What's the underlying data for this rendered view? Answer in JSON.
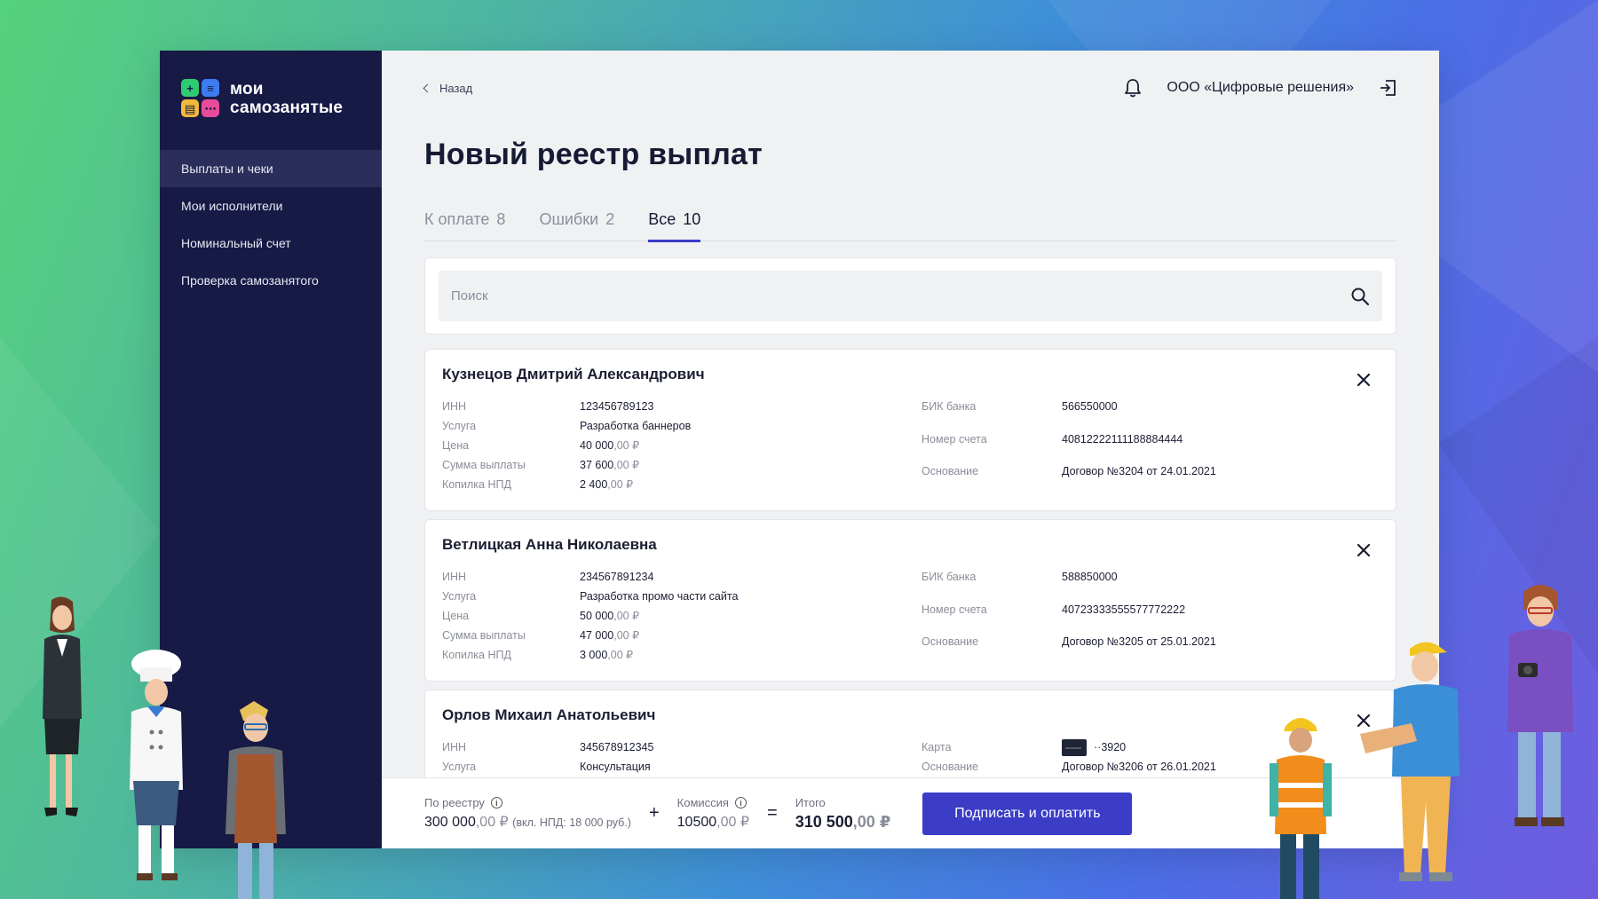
{
  "colors": {
    "sidebar": "#171a45",
    "accent": "#3b3dc7",
    "bg": "#f0f1f3"
  },
  "logo": {
    "line1": "мои",
    "line2": "самозанятые"
  },
  "sidebar": {
    "items": [
      {
        "label": "Выплаты и чеки",
        "active": true
      },
      {
        "label": "Мои исполнители"
      },
      {
        "label": "Номинальный счет"
      },
      {
        "label": "Проверка самозанятого"
      }
    ]
  },
  "header": {
    "back": "Назад",
    "org": "ООО «Цифровые решения»"
  },
  "page": {
    "title": "Новый реестр выплат"
  },
  "tabs": [
    {
      "label": "К оплате",
      "count": "8"
    },
    {
      "label": "Ошибки",
      "count": "2"
    },
    {
      "label": "Все",
      "count": "10",
      "active": true
    }
  ],
  "search": {
    "placeholder": "Поиск"
  },
  "labels": {
    "inn": "ИНН",
    "service": "Услуга",
    "price": "Цена",
    "payout": "Сумма выплаты",
    "npd": "Копилка НПД",
    "bik": "БИК банка",
    "account": "Номер счета",
    "basis": "Основание",
    "card": "Карта"
  },
  "payees": [
    {
      "name": "Кузнецов Дмитрий Александрович",
      "inn": "123456789123",
      "service": "Разработка баннеров",
      "price": "40 000",
      "price_kop": ",00 ₽",
      "payout": "37 600",
      "payout_kop": ",00 ₽",
      "npd": "2 400",
      "npd_kop": ",00 ₽",
      "bik": "566550000",
      "account": "40812222111188884444",
      "basis": "Договор №3204 от 24.01.2021"
    },
    {
      "name": "Ветлицкая Анна Николаевна",
      "inn": "234567891234",
      "service": "Разработка промо части сайта",
      "price": "50 000",
      "price_kop": ",00 ₽",
      "payout": "47 000",
      "payout_kop": ",00 ₽",
      "npd": "3 000",
      "npd_kop": ",00 ₽",
      "bik": "588850000",
      "account": "40723333555577772222",
      "basis": "Договор №3205 от 25.01.2021"
    },
    {
      "name": "Орлов Михаил Анатольевич",
      "inn": "345678912345",
      "service": "Консультация",
      "card": "··3920",
      "basis": "Договор №3206 от 26.01.2021"
    }
  ],
  "footer": {
    "registry_label": "По реестру",
    "registry_value": "300 000",
    "registry_kop": ",00 ₽",
    "registry_note": "(вкл. НПД: 18 000 руб.)",
    "plus": "+",
    "commission_label": "Комиссия",
    "commission_value": "10500",
    "commission_kop": ",00 ₽",
    "equals": "=",
    "total_label": "Итого",
    "total_value": "310 500",
    "total_kop": ",00 ₽",
    "pay_button": "Подписать и оплатить"
  }
}
